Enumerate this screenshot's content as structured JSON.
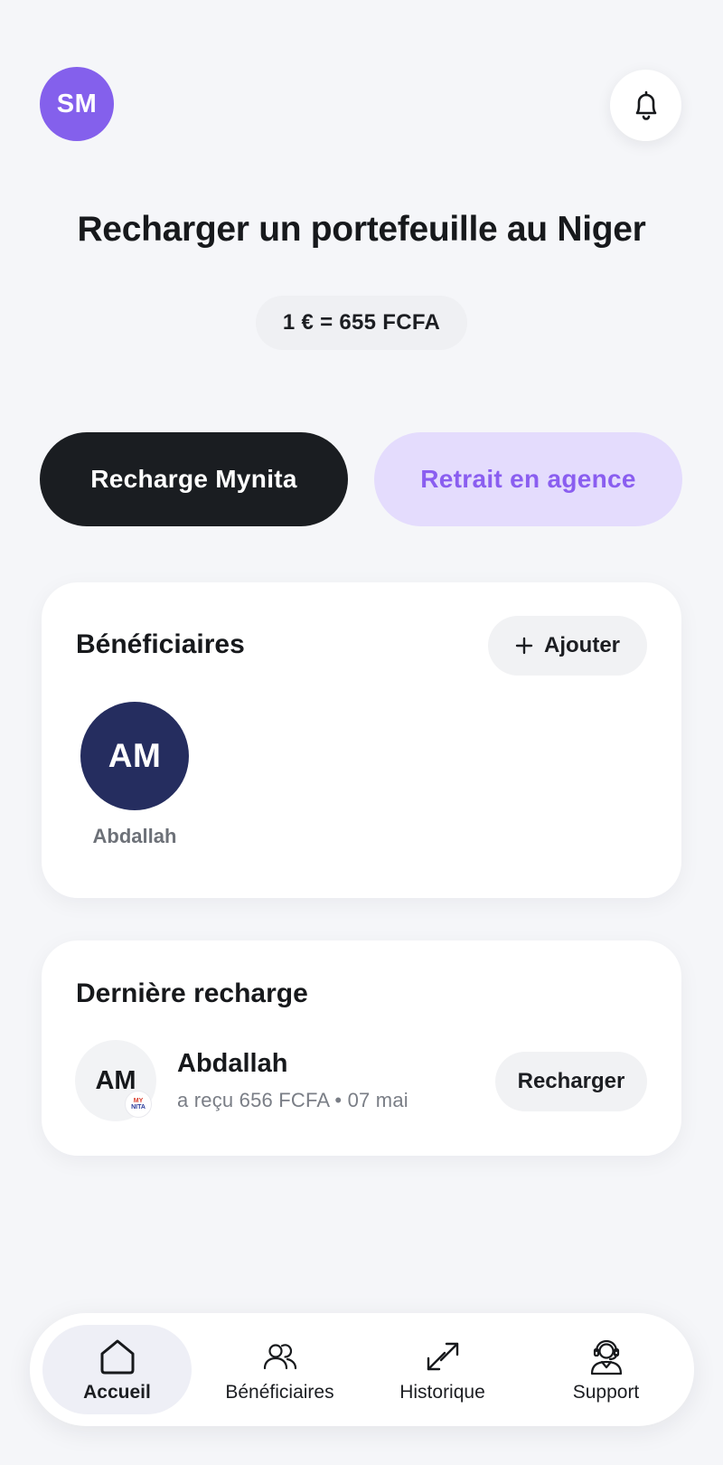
{
  "header": {
    "avatar_initials": "SM",
    "notifications_icon": "bell-icon"
  },
  "title": "Recharger un portefeuille au Niger",
  "exchange_rate": "1 € = 655 FCFA",
  "modes": {
    "primary_label": "Recharge Mynita",
    "secondary_label": "Retrait en agence"
  },
  "beneficiaries": {
    "title": "Bénéficiaires",
    "add_label": "Ajouter",
    "items": [
      {
        "initials": "AM",
        "name": "Abdallah"
      }
    ]
  },
  "last_recharge": {
    "title": "Dernière recharge",
    "initials": "AM",
    "logo_text_1": "MY",
    "logo_text_2": "NITA",
    "name": "Abdallah",
    "description": "a reçu 656 FCFA • 07 mai",
    "action_label": "Recharger"
  },
  "nav": {
    "items": [
      {
        "label": "Accueil",
        "icon": "home-icon",
        "active": true
      },
      {
        "label": "Bénéficiaires",
        "icon": "users-icon",
        "active": false
      },
      {
        "label": "Historique",
        "icon": "transfer-arrows-icon",
        "active": false
      },
      {
        "label": "Support",
        "icon": "headset-agent-icon",
        "active": false
      }
    ]
  },
  "colors": {
    "accent": "#8460ec",
    "accent_soft": "#e4dcfd",
    "dark_button": "#1a1d21",
    "beneficiary_avatar": "#252d5f",
    "background": "#f5f6f9"
  }
}
